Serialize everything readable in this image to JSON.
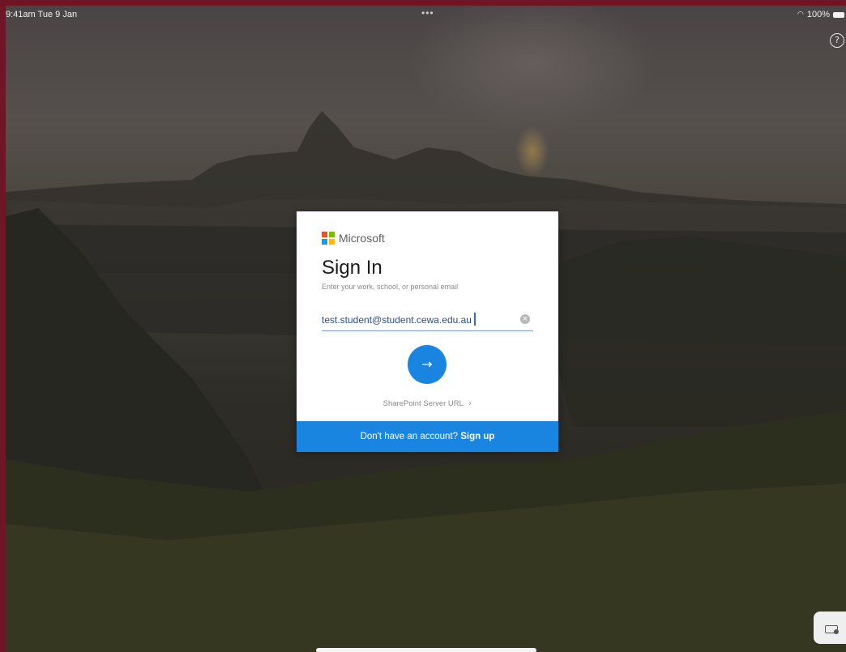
{
  "status_bar": {
    "time": "9:41am  Tue 9 Jan",
    "dots": "•••",
    "battery": "100%"
  },
  "help": {
    "icon": "?"
  },
  "card": {
    "brand": "Microsoft",
    "title": "Sign In",
    "subtitle": "Enter your work, school, or personal email",
    "email_value": "test.student@student.cewa.edu.au",
    "next_icon": "→",
    "sharepoint_link": "SharePoint Server URL",
    "signup_prompt": "Don't have an account?",
    "signup_link": "Sign up"
  },
  "colors": {
    "accent": "#1a85e0",
    "ms_red": "#f25022",
    "ms_green": "#7fba00",
    "ms_blue": "#00a4ef",
    "ms_yellow": "#ffb900",
    "frame": "#6e1526"
  }
}
